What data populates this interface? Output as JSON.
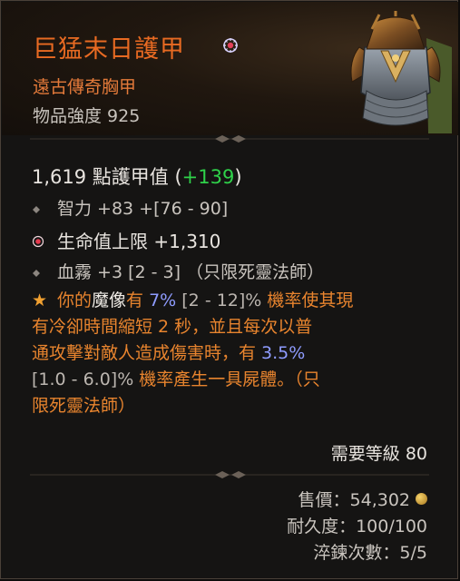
{
  "item": {
    "name": "巨猛末日護甲",
    "type": "遠古傳奇胸甲",
    "power": "物品強度 925"
  },
  "armor": {
    "value": "1,619 點護甲值",
    "bonus_open": " (",
    "bonus": "+139",
    "bonus_close": ")"
  },
  "affixes": [
    {
      "text": "智力 +83 +[76 - 90]"
    },
    {
      "text": "生命值上限 +1,310"
    },
    {
      "text": "血霧 +3 [2 - 3] （只限死靈法師）"
    }
  ],
  "legendary": {
    "l1a": "你的",
    "l1b": "魔像",
    "l1c": "有 ",
    "l1d": "7%",
    "l1e": " [2 - 12]%",
    "l1f": " 機率使其現",
    "l2": "有冷卻時間縮短 2 秒，並且每次以普",
    "l3a": "通攻擊對敵人造成傷害時，有 ",
    "l3b": "3.5%",
    "l4a": "[1.0 - 6.0]%",
    "l4b": " 機率產生一具屍體。（只",
    "l5": "限死靈法師）"
  },
  "requirement": "需要等級 80",
  "footer": {
    "price_label": "售價：54,302",
    "durability": "耐久度：100/100",
    "temper": "淬鍊次數：5/5"
  },
  "colors": {
    "title": "#e86a22",
    "bonus": "#2fd24a",
    "legendary": "#e8842e",
    "roll_value": "#8f9cff"
  },
  "icons": [
    "socket-gem-icon",
    "chest-armor-icon",
    "diamond-bullet-icon",
    "life-gem-icon",
    "legendary-star-icon",
    "gold-coin-icon"
  ]
}
